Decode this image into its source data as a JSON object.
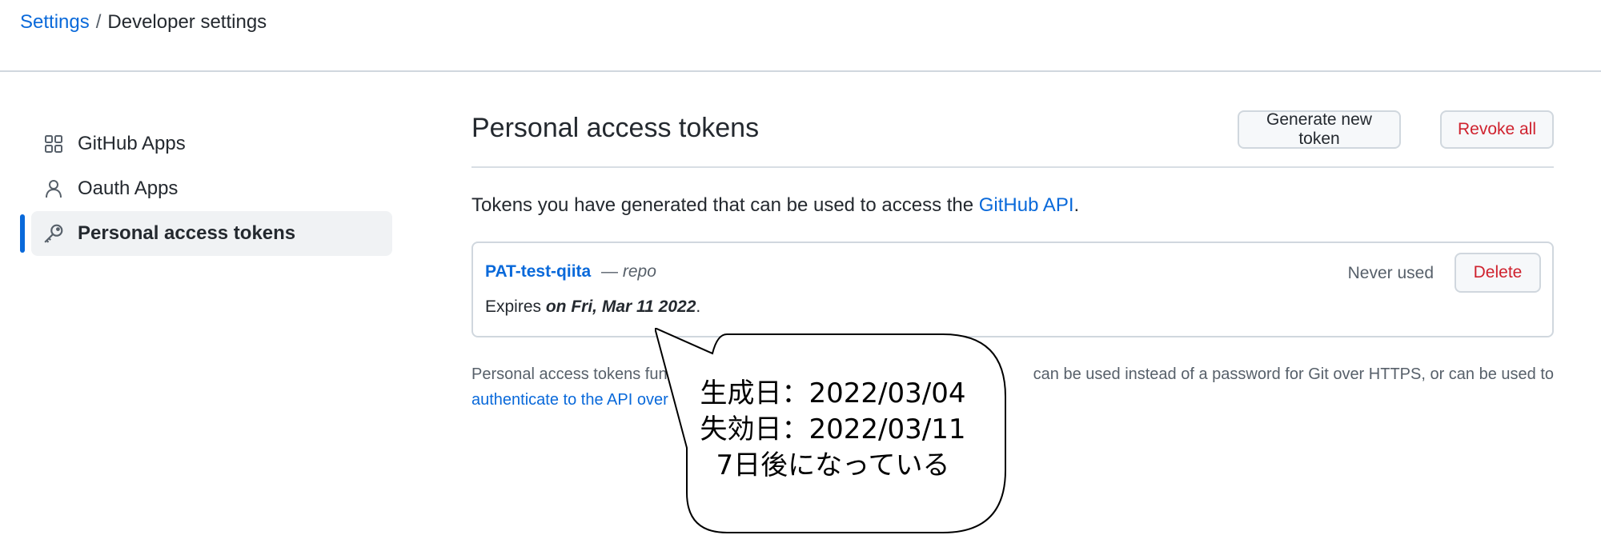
{
  "breadcrumb": {
    "root": "Settings",
    "separator": "/",
    "current": "Developer settings"
  },
  "sidebar": {
    "items": [
      {
        "label": "GitHub Apps",
        "icon": "apps-grid-icon",
        "active": false
      },
      {
        "label": "Oauth Apps",
        "icon": "person-icon",
        "active": false
      },
      {
        "label": "Personal access tokens",
        "icon": "key-icon",
        "active": true
      }
    ]
  },
  "main": {
    "title": "Personal access tokens",
    "generate_button": "Generate new token",
    "revoke_button": "Revoke all",
    "intro_prefix": "Tokens you have generated that can be used to access the ",
    "intro_link": "GitHub API",
    "intro_suffix": ".",
    "token": {
      "name": "PAT-test-qiita",
      "scope_separator": "—",
      "scope": "repo",
      "expires_prefix": "Expires ",
      "expires_date": "on Fri, Mar 11 2022",
      "expires_suffix": ".",
      "usage": "Never used",
      "delete_button": "Delete"
    },
    "footnote_line1_left": "Personal access tokens fun",
    "footnote_line1_right": "can be used instead of a password for Git over HTTPS, or can be used to",
    "footnote_link": "authenticate to the API over"
  },
  "callout": {
    "line1": "生成日：2022/03/04",
    "line2": "失効日：2022/03/11",
    "line3": "7日後になっている"
  },
  "colors": {
    "link": "#0969da",
    "danger": "#cf222e",
    "border": "#d0d7de",
    "active_bar": "#0969da"
  }
}
